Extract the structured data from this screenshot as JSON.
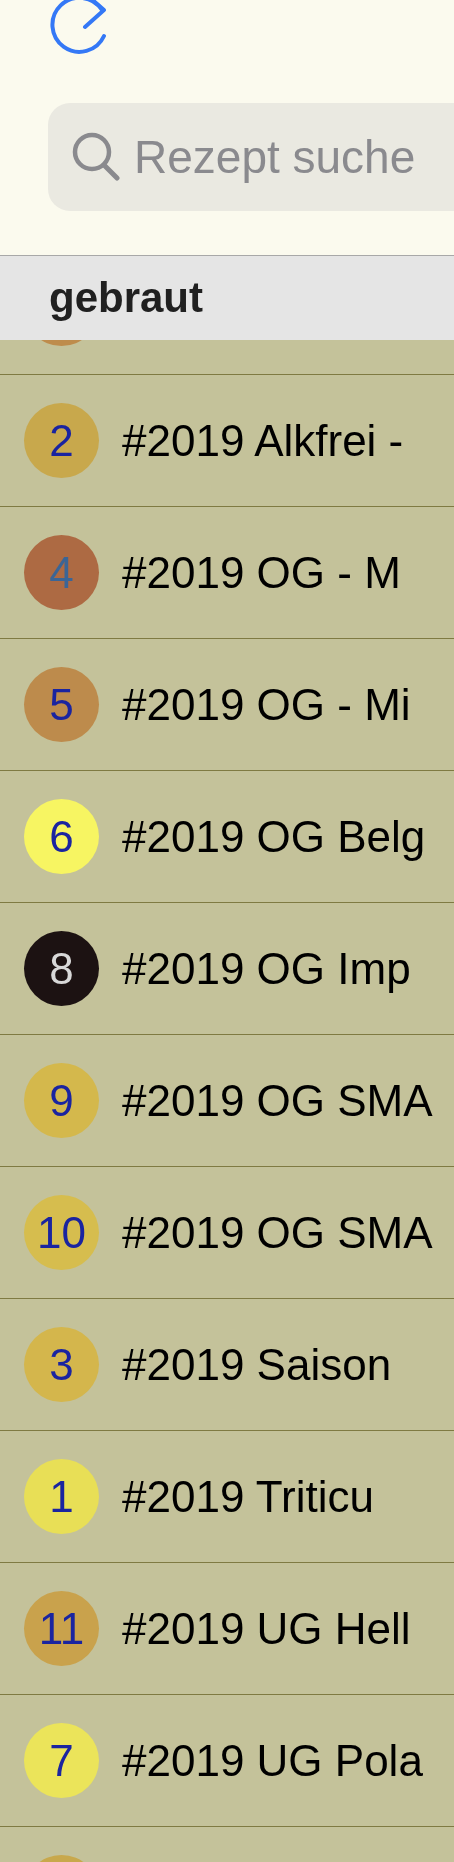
{
  "search": {
    "placeholder": "Rezept suche"
  },
  "section": {
    "title": "gebraut"
  },
  "recipes": [
    {
      "kind": "partial",
      "color": "#be8c4c"
    },
    {
      "kind": "full",
      "number": "2",
      "name": "#2019 Alkfrei -",
      "color": "#c8a84c"
    },
    {
      "kind": "full",
      "number": "4",
      "name": "#2019 OG - M",
      "color": "#ad6a43"
    },
    {
      "kind": "full",
      "number": "5",
      "name": "#2019 OG - Mi",
      "color": "#bd8b4c"
    },
    {
      "kind": "full",
      "number": "6",
      "name": "#2019 OG Belg",
      "color": "#f7f562"
    },
    {
      "kind": "full",
      "number": "8",
      "name": "#2019 OG Imp",
      "color": "#1c1212"
    },
    {
      "kind": "full",
      "number": "9",
      "name": "#2019 OG SMA",
      "color": "#d4b84c"
    },
    {
      "kind": "full",
      "number": "10",
      "name": "#2019 OG SMA",
      "color": "#d6bd4e"
    },
    {
      "kind": "full",
      "number": "3",
      "name": "#2019 Saison",
      "color": "#d4b64c"
    },
    {
      "kind": "full",
      "number": "1",
      "name": "#2019 Triticu",
      "color": "#e8df56"
    },
    {
      "kind": "full",
      "number": "11",
      "name": "#2019 UG Hell",
      "color": "#c9a24c"
    },
    {
      "kind": "full",
      "number": "7",
      "name": "#2019 UG Pola",
      "color": "#ebe45a"
    },
    {
      "kind": "partial",
      "color": "#c8a84c"
    }
  ]
}
